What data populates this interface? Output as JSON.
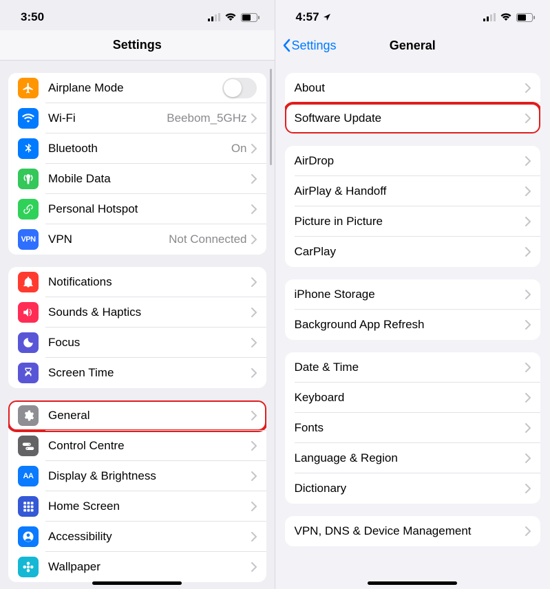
{
  "left": {
    "status": {
      "time": "3:50"
    },
    "nav": {
      "title": "Settings"
    },
    "groups": [
      {
        "rows": [
          {
            "key": "airplane",
            "label": "Airplane Mode",
            "icon": "airplane-icon",
            "color": "ic-orange",
            "control": "toggle",
            "toggle": false
          },
          {
            "key": "wifi",
            "label": "Wi-Fi",
            "icon": "wifi-icon",
            "color": "ic-blue",
            "value": "Beebom_5GHz",
            "control": "chevron"
          },
          {
            "key": "bluetooth",
            "label": "Bluetooth",
            "icon": "bluetooth-icon",
            "color": "ic-blue",
            "value": "On",
            "control": "chevron"
          },
          {
            "key": "mobiledata",
            "label": "Mobile Data",
            "icon": "antenna-icon",
            "color": "ic-green",
            "control": "chevron"
          },
          {
            "key": "hotspot",
            "label": "Personal Hotspot",
            "icon": "link-icon",
            "color": "ic-green2",
            "control": "chevron"
          },
          {
            "key": "vpn",
            "label": "VPN",
            "icon": "vpn-icon",
            "color": "ic-vpn",
            "value": "Not Connected",
            "control": "chevron",
            "icon_text": "VPN"
          }
        ]
      },
      {
        "rows": [
          {
            "key": "notifications",
            "label": "Notifications",
            "icon": "bell-icon",
            "color": "ic-red",
            "control": "chevron"
          },
          {
            "key": "sounds",
            "label": "Sounds & Haptics",
            "icon": "speaker-icon",
            "color": "ic-pink",
            "control": "chevron"
          },
          {
            "key": "focus",
            "label": "Focus",
            "icon": "moon-icon",
            "color": "ic-indigo",
            "control": "chevron"
          },
          {
            "key": "screentime",
            "label": "Screen Time",
            "icon": "hourglass-icon",
            "color": "ic-screentime",
            "control": "chevron"
          }
        ]
      },
      {
        "rows": [
          {
            "key": "general",
            "label": "General",
            "icon": "gear-icon",
            "color": "ic-gray",
            "control": "chevron",
            "highlight": true
          },
          {
            "key": "controlcentre",
            "label": "Control Centre",
            "icon": "switches-icon",
            "color": "ic-graydark",
            "control": "chevron"
          },
          {
            "key": "display",
            "label": "Display & Brightness",
            "icon": "text-size-icon",
            "color": "ic-aa",
            "control": "chevron",
            "icon_text": "AA"
          },
          {
            "key": "homescreen",
            "label": "Home Screen",
            "icon": "grid-icon",
            "color": "ic-home",
            "control": "chevron"
          },
          {
            "key": "accessibility",
            "label": "Accessibility",
            "icon": "person-icon",
            "color": "ic-access",
            "control": "chevron"
          },
          {
            "key": "wallpaper",
            "label": "Wallpaper",
            "icon": "flower-icon",
            "color": "ic-wall",
            "control": "chevron"
          }
        ]
      }
    ]
  },
  "right": {
    "status": {
      "time": "4:57",
      "location": true
    },
    "nav": {
      "back": "Settings",
      "title": "General"
    },
    "groups": [
      {
        "rows": [
          {
            "key": "about",
            "label": "About",
            "control": "chevron"
          },
          {
            "key": "softwareupdate",
            "label": "Software Update",
            "control": "chevron",
            "highlight": true
          }
        ]
      },
      {
        "rows": [
          {
            "key": "airdrop",
            "label": "AirDrop",
            "control": "chevron"
          },
          {
            "key": "airplay",
            "label": "AirPlay & Handoff",
            "control": "chevron"
          },
          {
            "key": "pip",
            "label": "Picture in Picture",
            "control": "chevron"
          },
          {
            "key": "carplay",
            "label": "CarPlay",
            "control": "chevron"
          }
        ]
      },
      {
        "rows": [
          {
            "key": "storage",
            "label": "iPhone Storage",
            "control": "chevron"
          },
          {
            "key": "bgrefresh",
            "label": "Background App Refresh",
            "control": "chevron"
          }
        ]
      },
      {
        "rows": [
          {
            "key": "datetime",
            "label": "Date & Time",
            "control": "chevron"
          },
          {
            "key": "keyboard",
            "label": "Keyboard",
            "control": "chevron"
          },
          {
            "key": "fonts",
            "label": "Fonts",
            "control": "chevron"
          },
          {
            "key": "language",
            "label": "Language & Region",
            "control": "chevron"
          },
          {
            "key": "dictionary",
            "label": "Dictionary",
            "control": "chevron"
          }
        ]
      },
      {
        "rows": [
          {
            "key": "vpndns",
            "label": "VPN, DNS & Device Management",
            "control": "chevron"
          }
        ]
      }
    ]
  }
}
